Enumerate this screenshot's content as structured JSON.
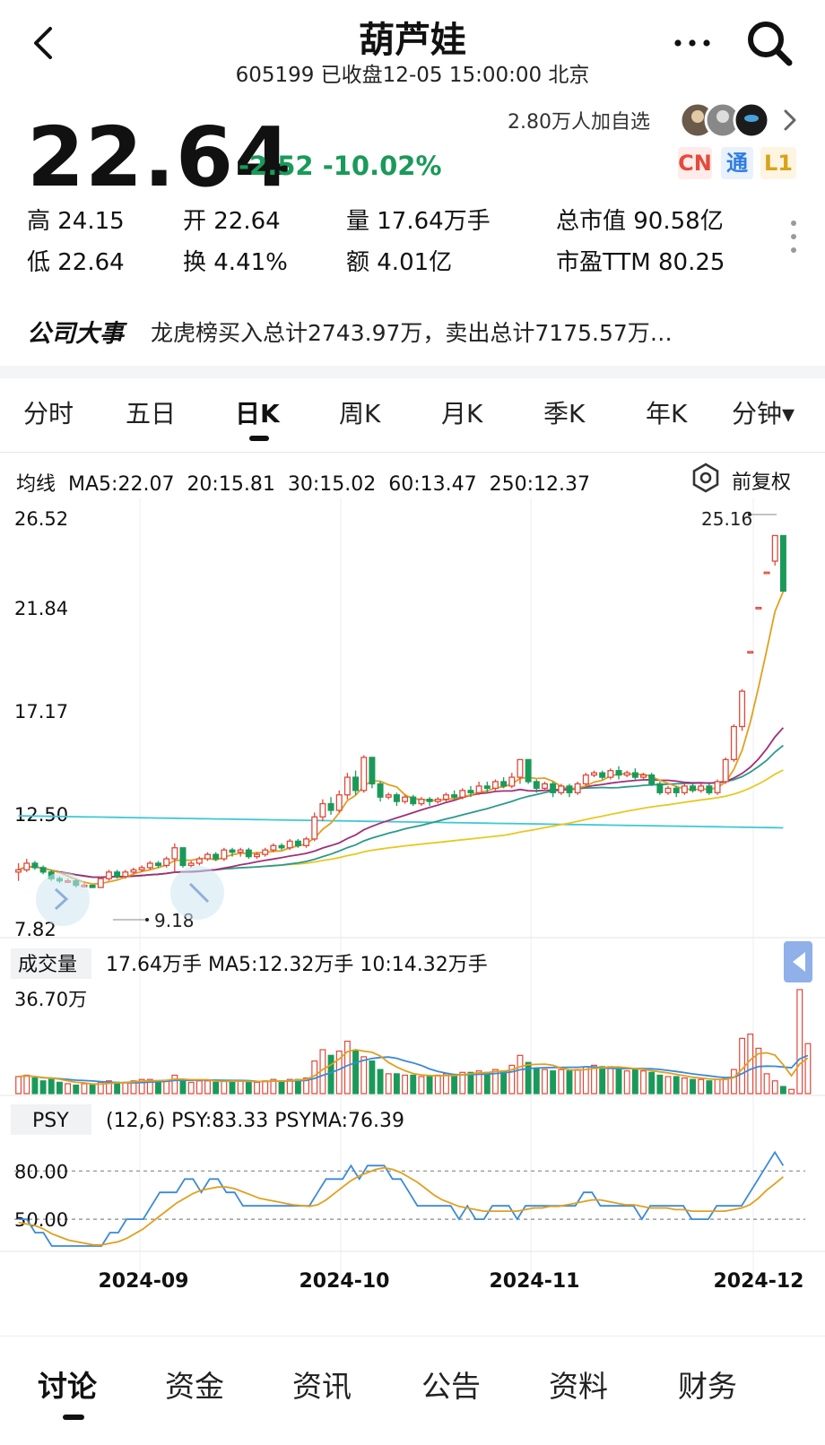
{
  "header": {
    "title": "葫芦娃",
    "subtitle": "605199 已收盘12-05 15:00:00 北京"
  },
  "quote": {
    "price": "22.64",
    "change": "-2.52",
    "change_pct": "-10.02%",
    "watchers": "2.80万人加自选",
    "badges": {
      "cn": "CN",
      "tong": "通",
      "l1": "L1"
    },
    "stats": {
      "high": "高 24.15",
      "open": "开 22.64",
      "volume": "量 17.64万手",
      "market_cap": "总市值 90.58亿",
      "low": "低 22.64",
      "turnover": "换 4.41%",
      "amount": "额 4.01亿",
      "pe_ttm": "市盈TTM 80.25"
    }
  },
  "event": {
    "label": "公司大事",
    "text": "龙虎榜买入总计2743.97万，卖出总计7175.57万…"
  },
  "tabs": [
    "分时",
    "五日",
    "日K",
    "周K",
    "月K",
    "季K",
    "年K",
    "分钟▾"
  ],
  "active_tab": "日K",
  "ma_legend": {
    "label": "均线",
    "ma5": "MA5:22.07",
    "ma20": "20:15.81",
    "ma30": "30:15.02",
    "ma60": "60:13.47",
    "ma250": "250:12.37",
    "adjust": "前复权"
  },
  "colors": {
    "up": "#e0483b",
    "down": "#1a9a5a",
    "ma5": "#e0a020",
    "ma20": "#a0307a",
    "ma30": "#2a9a8c",
    "ma60": "#e8c820",
    "ma250": "#3ec8d8",
    "psy": "#3a8ad8",
    "psyma": "#e0a020"
  },
  "chart_data": [
    {
      "type": "candlestick",
      "y_ticks": [
        "26.52",
        "21.84",
        "17.17",
        "12.50",
        "7.82"
      ],
      "ylim": [
        7.82,
        26.52
      ],
      "max_label": "25.16",
      "min_label": "9.18",
      "x_ticks": [
        "2024-09",
        "2024-10",
        "2024-11",
        "2024-12"
      ],
      "candles": [
        [
          9.9,
          10.0,
          9.5,
          10.3
        ],
        [
          10.0,
          10.3,
          9.9,
          10.5
        ],
        [
          10.3,
          10.1,
          10.0,
          10.4
        ],
        [
          10.1,
          9.9,
          9.8,
          10.2
        ],
        [
          9.9,
          9.6,
          9.5,
          10.0
        ],
        [
          9.6,
          9.5,
          9.4,
          9.7
        ],
        [
          9.5,
          9.5,
          9.4,
          9.6
        ],
        [
          9.5,
          9.3,
          9.2,
          9.6
        ],
        [
          9.3,
          9.3,
          9.2,
          9.4
        ],
        [
          9.3,
          9.2,
          9.18,
          9.3
        ],
        [
          9.2,
          9.6,
          9.2,
          9.7
        ],
        [
          9.6,
          9.9,
          9.5,
          10.0
        ],
        [
          9.9,
          9.7,
          9.6,
          10.0
        ],
        [
          9.7,
          9.9,
          9.6,
          10.0
        ],
        [
          9.9,
          10.0,
          9.8,
          10.1
        ],
        [
          10.0,
          10.1,
          9.9,
          10.2
        ],
        [
          10.1,
          10.3,
          10.0,
          10.4
        ],
        [
          10.3,
          10.2,
          10.1,
          10.4
        ],
        [
          10.2,
          10.5,
          10.1,
          10.6
        ],
        [
          10.5,
          11.0,
          9.9,
          11.2
        ],
        [
          11.0,
          10.2,
          10.1,
          11.0
        ],
        [
          10.2,
          10.3,
          10.1,
          10.4
        ],
        [
          10.3,
          10.5,
          10.2,
          10.6
        ],
        [
          10.5,
          10.7,
          10.4,
          10.8
        ],
        [
          10.7,
          10.5,
          10.4,
          10.8
        ],
        [
          10.5,
          10.9,
          10.4,
          11.0
        ],
        [
          10.9,
          10.8,
          10.6,
          11.0
        ],
        [
          10.8,
          10.9,
          10.6,
          11.0
        ],
        [
          10.9,
          10.6,
          10.5,
          11.0
        ],
        [
          10.6,
          10.7,
          10.5,
          10.8
        ],
        [
          10.7,
          10.9,
          10.6,
          11.0
        ],
        [
          10.9,
          11.1,
          10.8,
          11.2
        ],
        [
          11.1,
          11.0,
          10.9,
          11.2
        ],
        [
          11.0,
          11.3,
          10.9,
          11.4
        ],
        [
          11.3,
          11.1,
          11.0,
          11.4
        ],
        [
          11.1,
          11.4,
          11.0,
          11.5
        ],
        [
          11.4,
          12.4,
          11.3,
          12.6
        ],
        [
          12.4,
          13.0,
          12.2,
          13.2
        ],
        [
          13.0,
          12.7,
          12.5,
          13.3
        ],
        [
          12.7,
          13.4,
          12.6,
          13.6
        ],
        [
          13.4,
          14.2,
          13.2,
          14.4
        ],
        [
          14.2,
          13.6,
          13.4,
          14.5
        ],
        [
          13.6,
          15.1,
          13.5,
          15.2
        ],
        [
          15.1,
          13.9,
          13.7,
          15.1
        ],
        [
          13.9,
          13.3,
          13.1,
          14.0
        ],
        [
          13.3,
          13.4,
          13.2,
          13.5
        ],
        [
          13.4,
          13.1,
          12.9,
          13.5
        ],
        [
          13.1,
          13.3,
          13.0,
          13.4
        ],
        [
          13.3,
          13.0,
          12.9,
          13.4
        ],
        [
          13.0,
          13.2,
          12.9,
          13.3
        ],
        [
          13.2,
          13.1,
          12.9,
          13.3
        ],
        [
          13.1,
          13.2,
          13.0,
          13.3
        ],
        [
          13.2,
          13.4,
          13.1,
          13.5
        ],
        [
          13.4,
          13.3,
          13.2,
          13.6
        ],
        [
          13.3,
          13.6,
          13.2,
          13.7
        ],
        [
          13.6,
          13.5,
          13.3,
          13.8
        ],
        [
          13.5,
          13.8,
          13.4,
          14.0
        ],
        [
          13.8,
          13.7,
          13.5,
          14.0
        ],
        [
          13.7,
          14.0,
          13.6,
          14.1
        ],
        [
          14.0,
          13.8,
          13.7,
          14.2
        ],
        [
          13.8,
          14.2,
          13.7,
          14.4
        ],
        [
          14.2,
          15.0,
          13.9,
          15.0
        ],
        [
          15.0,
          14.0,
          13.9,
          15.0
        ],
        [
          14.0,
          13.7,
          13.5,
          14.1
        ],
        [
          13.7,
          13.9,
          13.6,
          14.0
        ],
        [
          13.9,
          13.5,
          13.3,
          14.0
        ],
        [
          13.5,
          13.8,
          13.4,
          13.9
        ],
        [
          13.8,
          13.5,
          13.3,
          13.9
        ],
        [
          13.5,
          13.9,
          13.4,
          14.0
        ],
        [
          13.9,
          14.3,
          13.8,
          14.4
        ],
        [
          14.3,
          14.4,
          14.2,
          14.5
        ],
        [
          14.4,
          14.2,
          14.1,
          14.5
        ],
        [
          14.2,
          14.5,
          14.1,
          14.6
        ],
        [
          14.5,
          14.3,
          14.1,
          14.7
        ],
        [
          14.3,
          14.4,
          14.2,
          14.5
        ],
        [
          14.4,
          14.2,
          14.1,
          14.6
        ],
        [
          14.2,
          14.3,
          14.1,
          14.4
        ],
        [
          14.3,
          13.9,
          13.8,
          14.4
        ],
        [
          13.9,
          13.5,
          13.4,
          14.0
        ],
        [
          13.5,
          13.7,
          13.4,
          13.8
        ],
        [
          13.7,
          13.5,
          13.3,
          13.8
        ],
        [
          13.5,
          13.8,
          13.4,
          13.9
        ],
        [
          13.8,
          13.6,
          13.5,
          13.9
        ],
        [
          13.6,
          13.8,
          13.5,
          13.9
        ],
        [
          13.8,
          13.5,
          13.4,
          13.9
        ],
        [
          13.5,
          14.0,
          13.4,
          14.1
        ],
        [
          14.0,
          15.0,
          13.9,
          15.1
        ],
        [
          15.0,
          16.5,
          14.9,
          16.6
        ],
        [
          16.5,
          18.1,
          16.3,
          18.2
        ],
        [
          19.9,
          19.9,
          19.9,
          19.9
        ],
        [
          21.9,
          21.9,
          21.9,
          21.9
        ],
        [
          23.5,
          23.5,
          23.5,
          23.5
        ],
        [
          24.0,
          25.16,
          23.8,
          25.16
        ],
        [
          25.16,
          22.64,
          22.64,
          24.15
        ]
      ]
    },
    {
      "type": "bar",
      "title": "成交量",
      "legend": "17.64万手 MA5:12.32万手 10:14.32万手",
      "y_max_label": "36.70万",
      "values": [
        6.0,
        6.5,
        5.5,
        4.5,
        5.0,
        4.0,
        3.5,
        3.0,
        3.5,
        3.0,
        4.0,
        4.5,
        4.0,
        4.0,
        4.5,
        5.0,
        5.0,
        4.5,
        4.5,
        6.5,
        5.0,
        4.0,
        4.5,
        4.5,
        4.0,
        4.5,
        4.5,
        4.5,
        4.0,
        4.0,
        4.5,
        5.0,
        4.5,
        5.0,
        5.0,
        5.5,
        11.5,
        15.5,
        13.5,
        15.0,
        18.5,
        15.0,
        13.0,
        11.5,
        8.5,
        7.0,
        7.0,
        6.5,
        6.5,
        6.0,
        6.0,
        6.5,
        7.0,
        6.5,
        7.5,
        7.5,
        8.0,
        7.5,
        8.5,
        8.0,
        10.0,
        13.5,
        11.0,
        9.0,
        8.5,
        8.0,
        8.5,
        8.0,
        8.5,
        9.5,
        10.0,
        9.5,
        9.5,
        8.5,
        8.0,
        8.5,
        8.0,
        7.5,
        6.5,
        6.0,
        6.0,
        5.5,
        5.0,
        5.0,
        4.5,
        5.0,
        5.5,
        8.5,
        19.5,
        21.0,
        16.0,
        7.0,
        4.5,
        2.5,
        1.5,
        36.7,
        17.64
      ]
    },
    {
      "type": "line",
      "title": "PSY",
      "legend": "(12,6) PSY:83.33 PSYMA:76.39",
      "y_ticks": [
        "80.00",
        "50.00"
      ],
      "series": [
        {
          "name": "PSY",
          "values": [
            50,
            50,
            41.67,
            41.67,
            33.33,
            33.33,
            33.33,
            33.33,
            33.33,
            33.33,
            33.33,
            41.67,
            41.67,
            50,
            50,
            50,
            58.33,
            66.67,
            66.67,
            66.67,
            75,
            75,
            66.67,
            75,
            75,
            66.67,
            66.67,
            58.33,
            58.33,
            58.33,
            58.33,
            58.33,
            58.33,
            58.33,
            58.33,
            58.33,
            66.67,
            75,
            75,
            75,
            83.33,
            75,
            83.33,
            83.33,
            83.33,
            75,
            75,
            66.67,
            58.33,
            58.33,
            58.33,
            58.33,
            58.33,
            50,
            58.33,
            50,
            50,
            58.33,
            58.33,
            58.33,
            50,
            58.33,
            58.33,
            58.33,
            58.33,
            58.33,
            58.33,
            58.33,
            66.67,
            66.67,
            58.33,
            58.33,
            58.33,
            58.33,
            58.33,
            50,
            58.33,
            58.33,
            58.33,
            58.33,
            58.33,
            50,
            50,
            50,
            58.33,
            58.33,
            58.33,
            58.33,
            66.67,
            75,
            83.33,
            91.67,
            83.33
          ]
        },
        {
          "name": "PSYMA",
          "values": [
            48,
            47,
            46,
            44,
            41,
            39,
            37,
            36,
            35,
            34,
            34,
            35,
            36,
            38,
            41,
            44,
            48,
            52,
            56,
            60,
            63,
            66,
            68,
            69,
            70,
            70,
            69,
            67,
            65,
            63,
            62,
            61,
            60,
            59,
            58.5,
            58,
            59,
            62,
            66,
            70,
            74,
            77,
            79,
            81,
            82,
            81,
            79,
            76,
            73,
            69,
            65,
            62,
            60,
            58,
            57,
            56,
            55,
            55,
            55,
            55,
            55,
            56,
            57,
            57,
            58,
            58,
            59,
            60,
            61,
            62,
            62,
            61,
            60,
            59,
            59,
            58,
            57,
            57,
            57,
            56,
            56,
            55,
            55,
            55,
            55,
            55,
            56,
            57,
            59,
            63,
            68,
            72,
            76.39
          ]
        }
      ]
    }
  ],
  "bottom_nav": [
    "讨论",
    "资金",
    "资讯",
    "公告",
    "资料",
    "财务"
  ],
  "bottom_nav_active": "讨论"
}
